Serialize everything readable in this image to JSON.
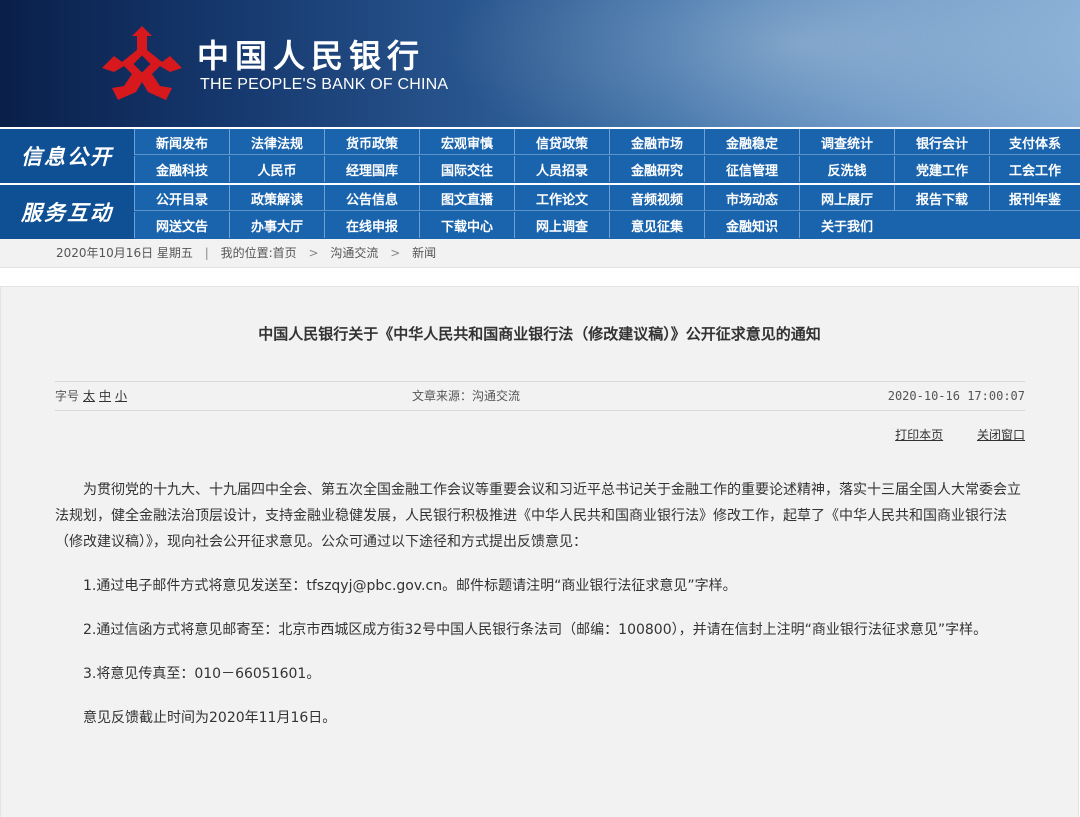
{
  "header": {
    "logo_cn": "中国人民银行",
    "logo_en": "THE PEOPLE'S BANK OF CHINA",
    "logo_icon": "pboc-emblem-icon",
    "brand_red": "#d7191d"
  },
  "nav": {
    "section1": "信息公开",
    "section2": "服务互动",
    "row1_top": [
      "新闻发布",
      "法律法规",
      "货币政策",
      "宏观审慎",
      "信贷政策",
      "金融市场",
      "金融稳定",
      "调查统计",
      "银行会计",
      "支付体系"
    ],
    "row1_bottom": [
      "金融科技",
      "人民币",
      "经理国库",
      "国际交往",
      "人员招录",
      "金融研究",
      "征信管理",
      "反洗钱",
      "党建工作",
      "工会工作"
    ],
    "row2_top": [
      "公开目录",
      "政策解读",
      "公告信息",
      "图文直播",
      "工作论文",
      "音频视频",
      "市场动态",
      "网上展厅",
      "报告下载",
      "报刊年鉴"
    ],
    "row2_bottom": [
      "网送文告",
      "办事大厅",
      "在线申报",
      "下载中心",
      "网上调查",
      "意见征集",
      "金融知识",
      "关于我们"
    ],
    "color": "#1a64ae"
  },
  "breadcrumb": {
    "date": "2020年10月16日 星期五",
    "location_label": "我的位置:",
    "items": [
      "首页",
      "沟通交流",
      "新闻"
    ]
  },
  "article": {
    "title": "中国人民银行关于《中华人民共和国商业银行法（修改建议稿）》公开征求意见的通知",
    "font_label": "字号",
    "font_sizes": [
      "太",
      "中",
      "小"
    ],
    "source": "文章来源：沟通交流",
    "time": "2020-10-16 17:00:07",
    "print": "打印本页",
    "close": "关闭窗口",
    "paragraphs": [
      "为贯彻党的十九大、十九届四中全会、第五次全国金融工作会议等重要会议和习近平总书记关于金融工作的重要论述精神，落实十三届全国人大常委会立法规划，健全金融法治顶层设计，支持金融业稳健发展，人民银行积极推进《中华人民共和国商业银行法》修改工作，起草了《中华人民共和国商业银行法（修改建议稿）》，现向社会公开征求意见。公众可通过以下途径和方式提出反馈意见：",
      "1.通过电子邮件方式将意见发送至：tfszqyj@pbc.gov.cn。邮件标题请注明“商业银行法征求意见”字样。",
      "2.通过信函方式将意见邮寄至：北京市西城区成方街32号中国人民银行条法司（邮编：100800），并请在信封上注明“商业银行法征求意见”字样。",
      "3.将意见传真至：010－66051601。",
      "意见反馈截止时间为2020年11月16日。"
    ]
  }
}
